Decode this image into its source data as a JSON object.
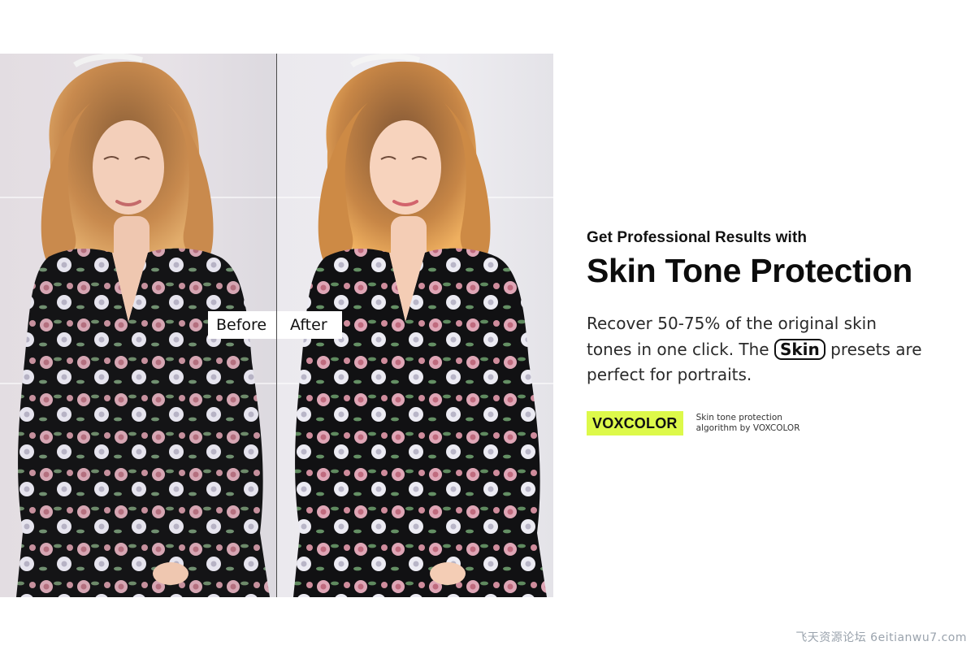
{
  "comparison": {
    "before_label": "Before",
    "after_label": "After"
  },
  "copy": {
    "kicker": "Get Professional Results with",
    "headline": "Skin Tone Protection",
    "body_line1": "Recover 50-75% of the original skin",
    "body_line2_prefix": "tones in one click.  The",
    "body_pill": "Skin",
    "body_line2_suffix": " presets are",
    "body_line3": "perfect for portraits."
  },
  "brand": {
    "badge": "VOXCOLOR",
    "note_line1": "Skin tone protection",
    "note_line2": "algorithm by VOXCOLOR",
    "accent": "#ddf94a"
  },
  "watermark": "飞天资源论坛 6eitianwu7.com"
}
